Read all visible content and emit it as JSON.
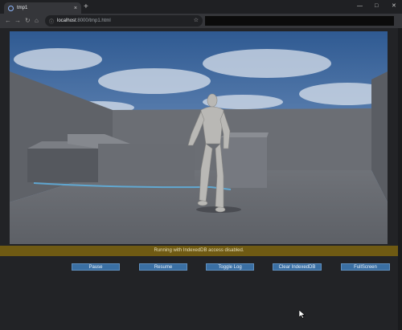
{
  "browser": {
    "tab_title": "tmp1",
    "tab_close": "×",
    "new_tab": "+",
    "url_host": "localhost",
    "url_rest": ":8000/tmp1.html",
    "window_controls": [
      "—",
      "□",
      "✕"
    ],
    "nav": [
      "←",
      "→",
      "↻",
      "⌂"
    ]
  },
  "status": {
    "message": "Running with IndexedDB access disabled."
  },
  "controls": [
    {
      "label": "Pause"
    },
    {
      "label": "Resume"
    },
    {
      "label": "Toggle Log"
    },
    {
      "label": "Clear IndexedDB"
    },
    {
      "label": "FullScreen"
    }
  ],
  "colors": {
    "status_bg": "#6f5a13",
    "button_bg": "#3a6fa3",
    "background": "#232426"
  }
}
